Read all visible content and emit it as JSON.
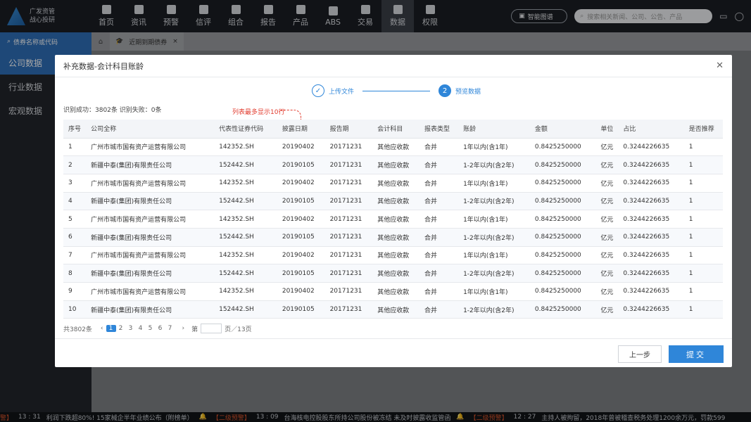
{
  "topbar": {
    "logo": [
      "广发资管",
      "战心投研"
    ],
    "nav": [
      {
        "label": "首页",
        "icon": "home-icon"
      },
      {
        "label": "资讯",
        "icon": "news-icon"
      },
      {
        "label": "预警",
        "icon": "warning-icon"
      },
      {
        "label": "信评",
        "icon": "graduation-icon"
      },
      {
        "label": "组合",
        "icon": "portfolio-icon"
      },
      {
        "label": "报告",
        "icon": "report-icon"
      },
      {
        "label": "产品",
        "icon": "product-icon"
      },
      {
        "label": "ABS",
        "icon": "abs-icon"
      },
      {
        "label": "交易",
        "icon": "trade-icon"
      },
      {
        "label": "数据",
        "icon": "pie-chart-icon",
        "active": true
      },
      {
        "label": "权限",
        "icon": "shield-icon"
      }
    ],
    "smart_btn": "智能图谱",
    "search_placeholder": "搜索相关新闻、公司、公告、产品"
  },
  "sidebar": {
    "search": "债券名称或代码",
    "items": [
      "公司数据",
      "行业数据",
      "宏观数据"
    ],
    "active_index": 0
  },
  "tabs": {
    "page_tab": "近期到期债券"
  },
  "modal": {
    "title": "补充数据-会计科目账龄",
    "steps": [
      {
        "num": "",
        "label": "上传文件"
      },
      {
        "num": "2",
        "label": "预览数据"
      }
    ],
    "stats": "识别成功：3802条  识别失败：0条",
    "note": "列表最多显示10行",
    "columns": [
      "序号",
      "公司全称",
      "代表性证券代码",
      "披露日期",
      "报告期",
      "会计科目",
      "报表类型",
      "账龄",
      "金额",
      "单位",
      "占比",
      "是否推荐"
    ],
    "rows": [
      [
        "1",
        "广州市城市国有资产运营有限公司",
        "142352.SH",
        "20190402",
        "20171231",
        "其他应收款",
        "合并",
        "1年以内(含1年)",
        "0.8425250000",
        "亿元",
        "0.3244226635",
        "1"
      ],
      [
        "2",
        "新疆中泰(集团)有限责任公司",
        "152442.SH",
        "20190105",
        "20171231",
        "其他应收款",
        "合并",
        "1-2年以内(含2年)",
        "0.8425250000",
        "亿元",
        "0.3244226635",
        "1"
      ],
      [
        "3",
        "广州市城市国有资产运营有限公司",
        "142352.SH",
        "20190402",
        "20171231",
        "其他应收款",
        "合并",
        "1年以内(含1年)",
        "0.8425250000",
        "亿元",
        "0.3244226635",
        "1"
      ],
      [
        "4",
        "新疆中泰(集团)有限责任公司",
        "152442.SH",
        "20190105",
        "20171231",
        "其他应收款",
        "合并",
        "1-2年以内(含2年)",
        "0.8425250000",
        "亿元",
        "0.3244226635",
        "1"
      ],
      [
        "5",
        "广州市城市国有资产运营有限公司",
        "142352.SH",
        "20190402",
        "20171231",
        "其他应收款",
        "合并",
        "1年以内(含1年)",
        "0.8425250000",
        "亿元",
        "0.3244226635",
        "1"
      ],
      [
        "6",
        "新疆中泰(集团)有限责任公司",
        "152442.SH",
        "20190105",
        "20171231",
        "其他应收款",
        "合并",
        "1-2年以内(含2年)",
        "0.8425250000",
        "亿元",
        "0.3244226635",
        "1"
      ],
      [
        "7",
        "广州市城市国有资产运营有限公司",
        "142352.SH",
        "20190402",
        "20171231",
        "其他应收款",
        "合并",
        "1年以内(含1年)",
        "0.8425250000",
        "亿元",
        "0.3244226635",
        "1"
      ],
      [
        "8",
        "新疆中泰(集团)有限责任公司",
        "152442.SH",
        "20190105",
        "20171231",
        "其他应收款",
        "合并",
        "1-2年以内(含2年)",
        "0.8425250000",
        "亿元",
        "0.3244226635",
        "1"
      ],
      [
        "9",
        "广州市城市国有资产运营有限公司",
        "142352.SH",
        "20190402",
        "20171231",
        "其他应收款",
        "合并",
        "1年以内(含1年)",
        "0.8425250000",
        "亿元",
        "0.3244226635",
        "1"
      ],
      [
        "10",
        "新疆中泰(集团)有限责任公司",
        "152442.SH",
        "20190105",
        "20171231",
        "其他应收款",
        "合并",
        "1-2年以内(含2年)",
        "0.8425250000",
        "亿元",
        "0.3244226635",
        "1"
      ]
    ],
    "pager": {
      "total": "共3802条",
      "pages": [
        "1",
        "2",
        "3",
        "4",
        "5",
        "6",
        "7"
      ],
      "active_page": "1",
      "goto_prefix": "第",
      "goto_suffix": "页／13页"
    },
    "btn_prev": "上一步",
    "btn_submit": "提交"
  },
  "ticker": [
    {
      "tag": "警】",
      "time": "13 : 31",
      "text": "利润下跌超80%! 15家械企半年业绩公布（附榜单）"
    },
    {
      "tag": "【二级预警】",
      "time": "13 : 09",
      "text": "台海核电控股股东所持公司股份被冻结 未及时披露收监管函"
    },
    {
      "tag": "【二级预警】",
      "time": "12 : 27",
      "text": "主持人被拘留，2018年曾被稽查税务处理1200余万元，罚款599"
    }
  ]
}
